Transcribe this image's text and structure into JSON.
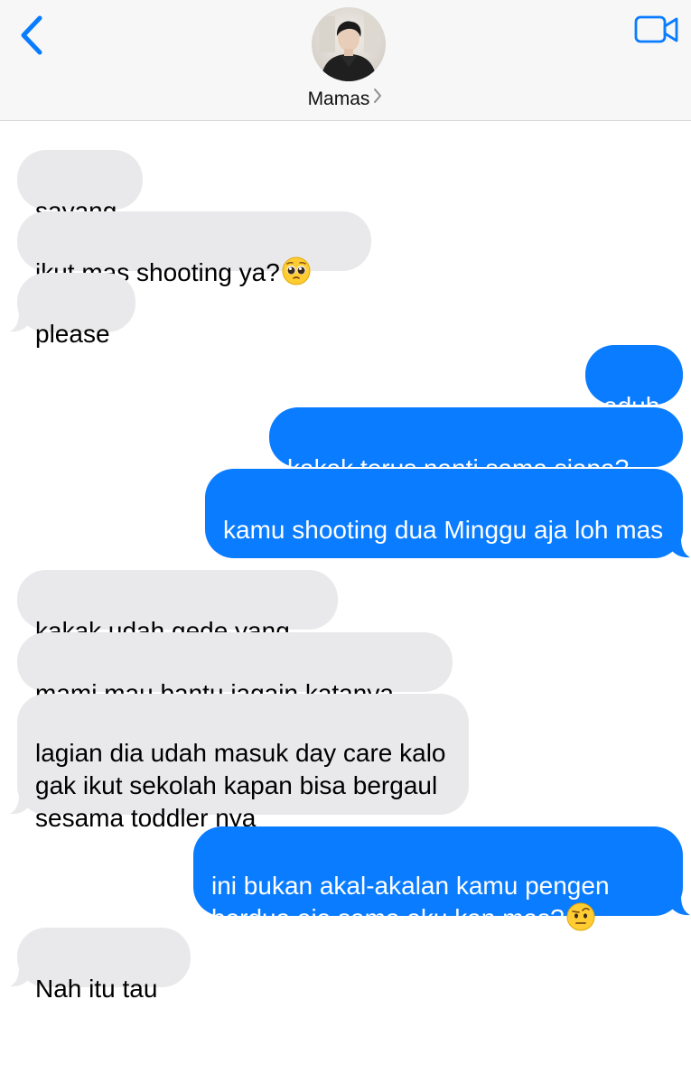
{
  "header": {
    "contact_name": "Mamas",
    "icons": {
      "back": "chevron-left-icon",
      "video": "video-camera-icon",
      "disclosure": "chevron-right-icon"
    },
    "accent_color": "#0a7cff"
  },
  "messages": [
    {
      "direction": "incoming",
      "text": "sayang"
    },
    {
      "direction": "incoming",
      "text": "ikut mas shooting ya?",
      "emoji": "pleading-face-emoji"
    },
    {
      "direction": "incoming",
      "text": "please"
    },
    {
      "direction": "outgoing",
      "text": "aduh"
    },
    {
      "direction": "outgoing",
      "text": "kakak terus nanti sama siapa?"
    },
    {
      "direction": "outgoing",
      "text": "kamu shooting dua Minggu aja loh mas"
    },
    {
      "direction": "incoming",
      "text": "kakak udah gede yang"
    },
    {
      "direction": "incoming",
      "text": "mami mau bantu jagain katanya"
    },
    {
      "direction": "incoming",
      "text": "lagian dia udah masuk day care kalo gak ikut sekolah kapan bisa bergaul sesama toddler nya"
    },
    {
      "direction": "outgoing",
      "text": "ini bukan akal-akalan kamu pengen berdua aja sama aku kan mas?",
      "emoji": "face-with-raised-eyebrow-emoji"
    },
    {
      "direction": "incoming",
      "text": "Nah itu tau"
    }
  ],
  "colors": {
    "incoming_bubble": "#e9e9eb",
    "outgoing_bubble": "#0a7cff",
    "header_bg": "#f7f7f7"
  }
}
